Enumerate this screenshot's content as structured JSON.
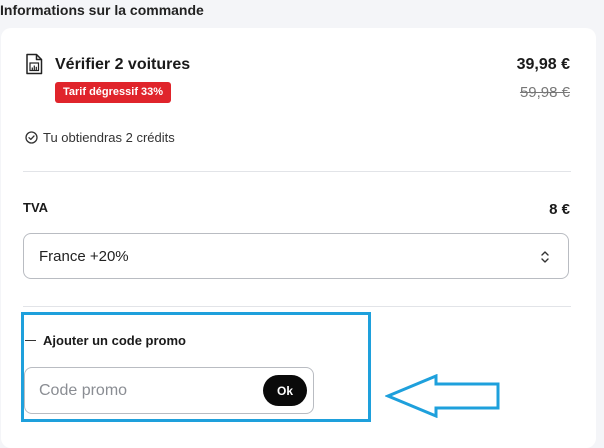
{
  "order": {
    "section_title": "Informations sur la commande",
    "product": {
      "icon": "document-chart-icon",
      "name": "Vérifier 2 voitures",
      "price": "39,98 €",
      "old_price": "59,98 €",
      "discount_badge": "Tarif dégressif 33%"
    },
    "credits": {
      "icon": "check-circle-icon",
      "text": "Tu obtiendras 2 crédits"
    },
    "vat": {
      "label": "TVA",
      "amount": "8 €",
      "selected_country": "France +20%"
    },
    "promo": {
      "title": "Ajouter un code promo",
      "placeholder": "Code promo",
      "value": "",
      "button_label": "Ok"
    }
  },
  "colors": {
    "badge": "#e0242b",
    "highlight": "#1ea0dc",
    "button": "#0a0a0a"
  }
}
